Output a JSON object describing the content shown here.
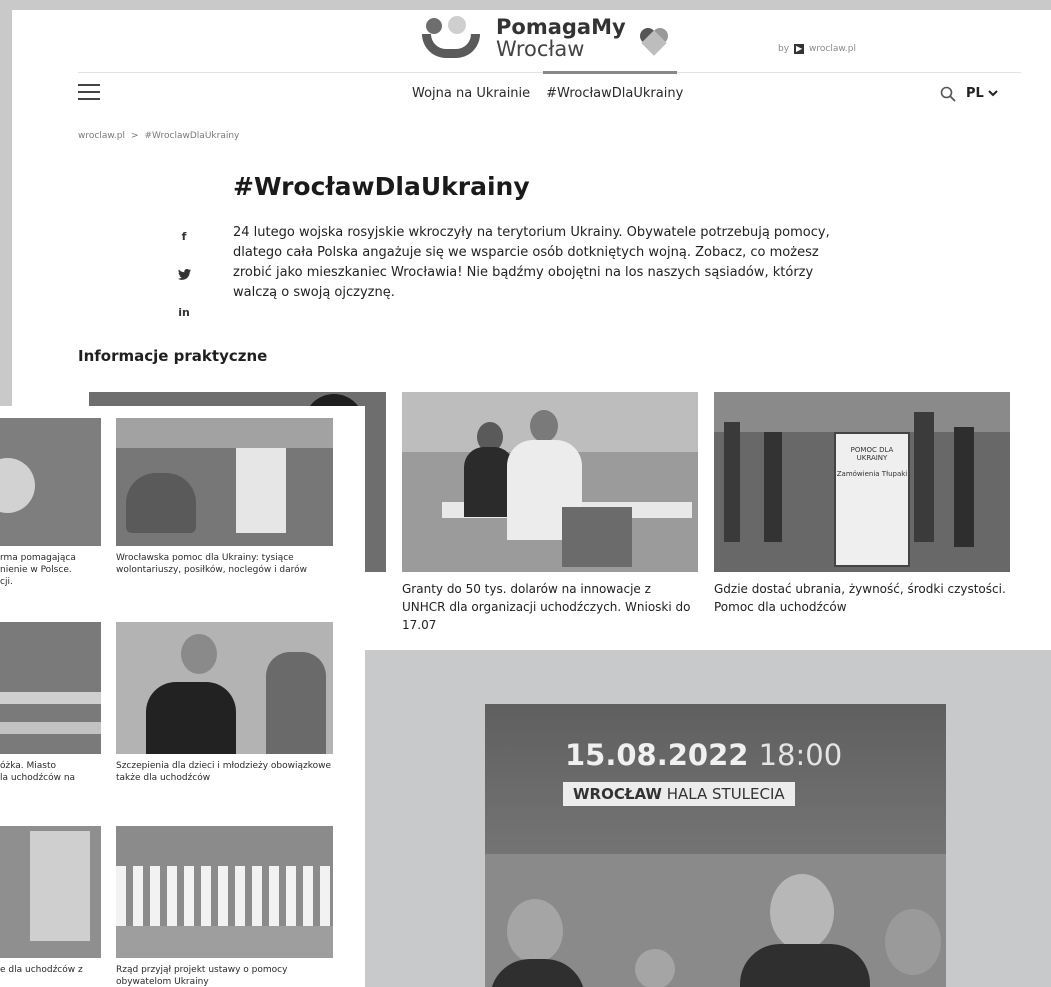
{
  "header": {
    "logo_line1": "PomagaMy",
    "logo_line2": "Wrocław",
    "by_prefix": "by",
    "by_logo_mark": "▶",
    "by_site": "wroclaw.pl",
    "nav": [
      "Wojna na Ukrainie",
      "#WrocławDlaUkrainy"
    ],
    "lang": "PL"
  },
  "breadcrumb": [
    "wroclaw.pl",
    ">",
    "#WroclawDlaUkrainy"
  ],
  "title": "#WrocławDlaUkrainy",
  "share": [
    "f",
    "t",
    "in"
  ],
  "intro": "24 lutego wojska rosyjskie wkroczyły na terytorium Ukrainy. Obywatele potrzebują pomocy, dlatego cała Polska angażuje się we wsparcie osób dotkniętych wojną. Zobacz, co możesz zrobić jako mieszkaniec Wrocławia! Nie bądźmy obojętni na los naszych sąsiadów, którzy walczą o swoją ojczyznę.",
  "section_title": "Informacje praktyczne",
  "tiles": [
    {
      "caption": "Granty do 50 tys. dolarów na innowacje z UNHCR dla organizacji uchodźczych. Wnioski do 17.07"
    },
    {
      "caption": "Gdzie dostać ubrania, żywność, środki czystości. Pomoc dla uchodźców",
      "sign_line1": "POMOC DLA",
      "sign_line2": "UKRAINY",
      "sign_line3": "Zamówienia Tłupaki"
    }
  ],
  "small_tiles": [
    {
      "caption": "rma pomagająca\nnienie w Polsce.\ncji."
    },
    {
      "caption": "Wrocławska pomoc dla Ukrainy: tysiące wolontariuszy, posiłków, noclegów i darów"
    },
    {
      "caption": "óżka. Miasto\nla uchodźców na"
    },
    {
      "caption": "Szczepienia dla dzieci i młodzieży obowiązkowe także dla uchodźców"
    },
    {
      "caption": "e dla uchodźców z"
    },
    {
      "caption": "Rząd przyjął projekt ustawy o pomocy obywatelom Ukrainy"
    }
  ],
  "poster": {
    "date": "15.08.2022",
    "time": "18:00",
    "city": "WROCŁAW",
    "venue": "HALA STULECIA"
  }
}
